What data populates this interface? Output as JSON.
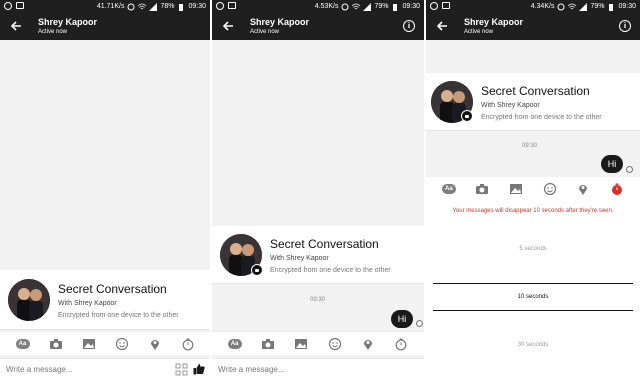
{
  "screens": [
    {
      "status": {
        "speed": "41.71K/s",
        "battery": "78%",
        "time": "09:30"
      },
      "header": {
        "title": "Shrey Kapoor",
        "subtitle": "Active now"
      },
      "card": {
        "title": "Secret Conversation",
        "with": "With Shrey Kapoor",
        "desc": "Encrypted from one device to the other"
      },
      "compose": {
        "placeholder": "Write a message..."
      },
      "toolbar": {
        "aa": "Aa"
      }
    },
    {
      "status": {
        "speed": "4.53K/s",
        "battery": "79%",
        "time": "09:30"
      },
      "header": {
        "title": "Shrey Kapoor",
        "subtitle": "Active now"
      },
      "card": {
        "title": "Secret Conversation",
        "with": "With Shrey Kapoor",
        "desc": "Encrypted from one device to the other"
      },
      "timestamp": "09:30",
      "message": "Hi",
      "compose": {
        "placeholder": "Write a message..."
      },
      "toolbar": {
        "aa": "Aa"
      }
    },
    {
      "status": {
        "speed": "4.34K/s",
        "battery": "79%",
        "time": "09:30"
      },
      "header": {
        "title": "Shrey Kapoor",
        "subtitle": "Active now"
      },
      "card": {
        "title": "Secret Conversation",
        "with": "With Shrey Kapoor",
        "desc": "Encrypted from one device to the other"
      },
      "timestamp": "09:30",
      "message": "Hi",
      "toolbar": {
        "aa": "Aa"
      },
      "timer": {
        "warning": "Your messages will disappear 10 seconds after they're seen.",
        "options": [
          "5 seconds",
          "10 seconds",
          "30 seconds"
        ],
        "selected": "10 seconds"
      }
    }
  ],
  "colors": {
    "bar": "#1f1f1f",
    "bubble": "#1a1a1a",
    "warning": "#c0392b",
    "timer_active": "#d93025"
  }
}
